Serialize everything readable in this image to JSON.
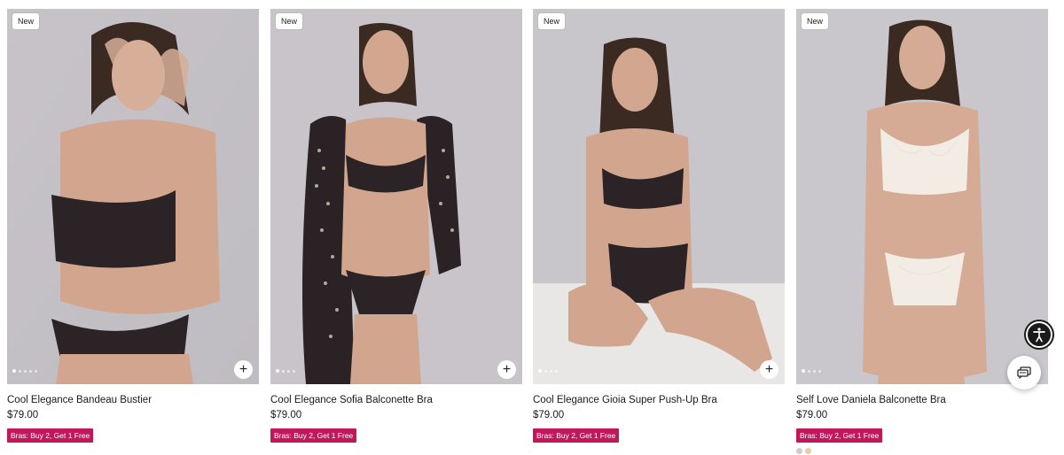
{
  "products": [
    {
      "badge": "New",
      "name": "Cool Elegance Bandeau Bustier",
      "price": "$79.00",
      "promo": "Bras: Buy 2, Get 1 Free",
      "add_icon": "plus-icon"
    },
    {
      "badge": "New",
      "name": "Cool Elegance Sofia Balconette Bra",
      "price": "$79.00",
      "promo": "Bras: Buy 2, Get 1 Free",
      "add_icon": "plus-icon"
    },
    {
      "badge": "New",
      "name": "Cool Elegance Gioia Super Push-Up Bra",
      "price": "$79.00",
      "promo": "Bras: Buy 2, Get 1 Free",
      "add_icon": "plus-icon"
    },
    {
      "badge": "New",
      "name": "Self Love Daniela Balconette Bra",
      "price": "$79.00",
      "promo": "Bras: Buy 2, Get 1 Free",
      "add_icon": "plus-icon",
      "swatches": [
        "#d8c9c2",
        "#f0c9a8"
      ]
    }
  ],
  "colors": {
    "promo_bg": "#c2185b",
    "accessibility_bg": "#1a1a1a"
  },
  "widgets": {
    "accessibility_icon": "accessibility-icon",
    "chat_icon": "chat-icon"
  }
}
